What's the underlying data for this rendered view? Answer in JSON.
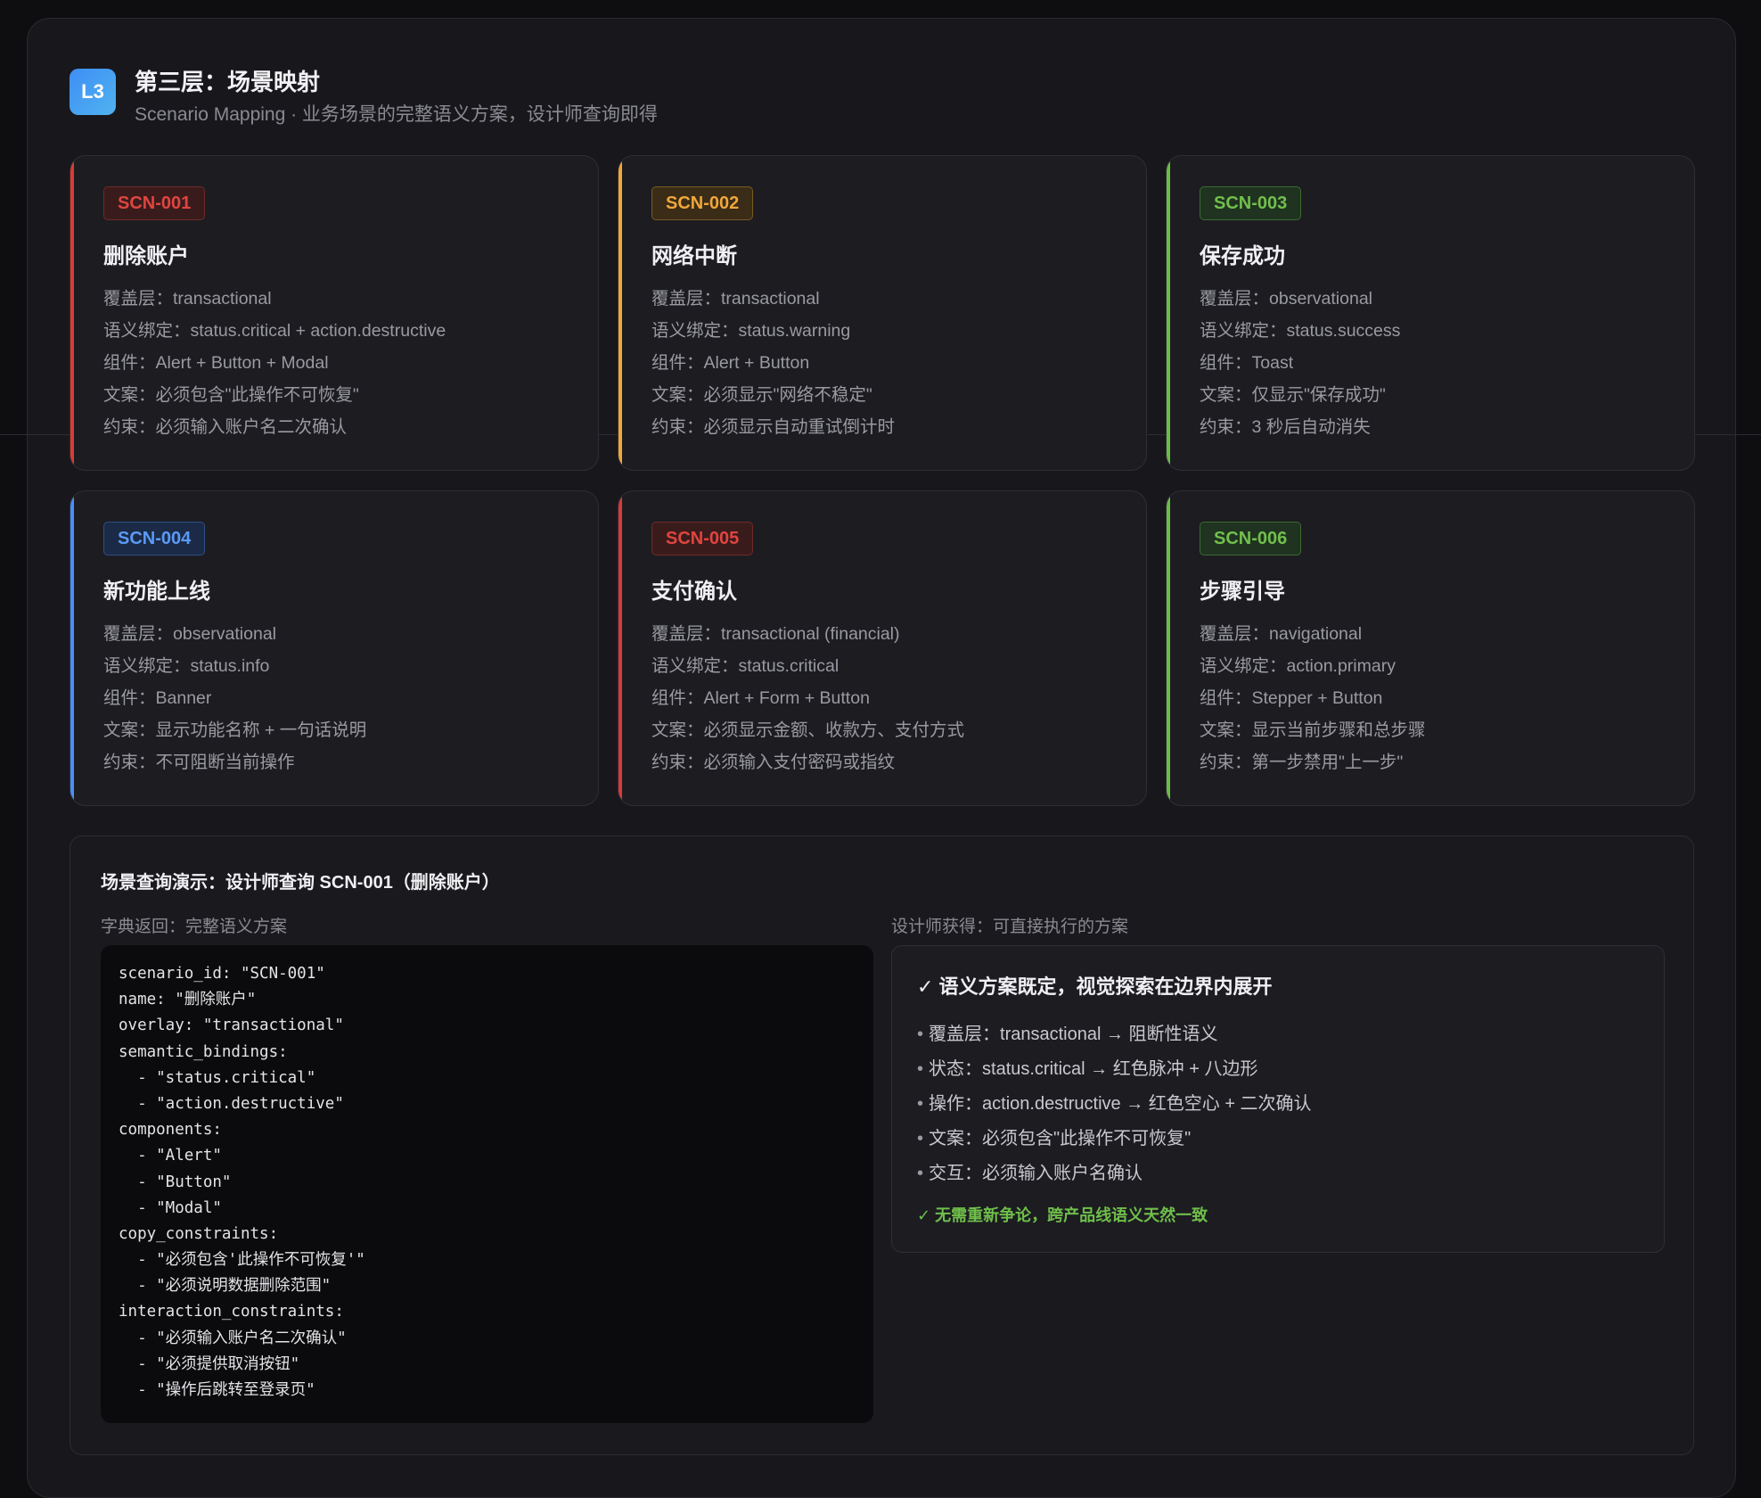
{
  "header": {
    "badge": "L3",
    "title": "第三层：场景映射",
    "subtitle": "Scenario Mapping · 业务场景的完整语义方案，设计师查询即得"
  },
  "colors": {
    "critical": "#d93b36",
    "warning": "#f0a73b",
    "success": "#6cbb48",
    "info": "#4a8ef5"
  },
  "cards": [
    {
      "id": "SCN-001",
      "title": "删除账户",
      "color": "critical",
      "lines": [
        "覆盖层：transactional",
        "语义绑定：status.critical + action.destructive",
        "组件：Alert + Button + Modal",
        "文案：必须包含\"此操作不可恢复\"",
        "约束：必须输入账户名二次确认"
      ]
    },
    {
      "id": "SCN-002",
      "title": "网络中断",
      "color": "warning",
      "lines": [
        "覆盖层：transactional",
        "语义绑定：status.warning",
        "组件：Alert + Button",
        "文案：必须显示\"网络不稳定\"",
        "约束：必须显示自动重试倒计时"
      ]
    },
    {
      "id": "SCN-003",
      "title": "保存成功",
      "color": "success",
      "lines": [
        "覆盖层：observational",
        "语义绑定：status.success",
        "组件：Toast",
        "文案：仅显示\"保存成功\"",
        "约束：3 秒后自动消失"
      ]
    },
    {
      "id": "SCN-004",
      "title": "新功能上线",
      "color": "info",
      "lines": [
        "覆盖层：observational",
        "语义绑定：status.info",
        "组件：Banner",
        "文案：显示功能名称 + 一句话说明",
        "约束：不可阻断当前操作"
      ]
    },
    {
      "id": "SCN-005",
      "title": "支付确认",
      "color": "critical",
      "lines": [
        "覆盖层：transactional (financial)",
        "语义绑定：status.critical",
        "组件：Alert + Form + Button",
        "文案：必须显示金额、收款方、支付方式",
        "约束：必须输入支付密码或指纹"
      ]
    },
    {
      "id": "SCN-006",
      "title": "步骤引导",
      "color": "success",
      "lines": [
        "覆盖层：navigational",
        "语义绑定：action.primary",
        "组件：Stepper + Button",
        "文案：显示当前步骤和总步骤",
        "约束：第一步禁用\"上一步\""
      ]
    }
  ],
  "demo": {
    "title": "场景查询演示：设计师查询 SCN-001（删除账户）",
    "left_label": "字典返回：完整语义方案",
    "right_label": "设计师获得：可直接执行的方案",
    "code_lines": [
      "scenario_id: \"SCN-001\"",
      "name: \"删除账户\"",
      "overlay: \"transactional\"",
      "semantic_bindings:",
      "  - \"status.critical\"",
      "  - \"action.destructive\"",
      "components:",
      "  - \"Alert\"",
      "  - \"Button\"",
      "  - \"Modal\"",
      "copy_constraints:",
      "  - \"必须包含'此操作不可恢复'\"",
      "  - \"必须说明数据删除范围\"",
      "interaction_constraints:",
      "  - \"必须输入账户名二次确认\"",
      "  - \"必须提供取消按钮\"",
      "  - \"操作后跳转至登录页\""
    ],
    "result": {
      "heading": "✓ 语义方案既定，视觉探索在边界内展开",
      "items": [
        "覆盖层：transactional → 阻断性语义",
        "状态：status.critical → 红色脉冲 + 八边形",
        "操作：action.destructive → 红色空心 + 二次确认",
        "文案：必须包含\"此操作不可恢复\"",
        "交互：必须输入账户名确认"
      ],
      "footer": "✓ 无需重新争论，跨产品线语义天然一致"
    }
  }
}
